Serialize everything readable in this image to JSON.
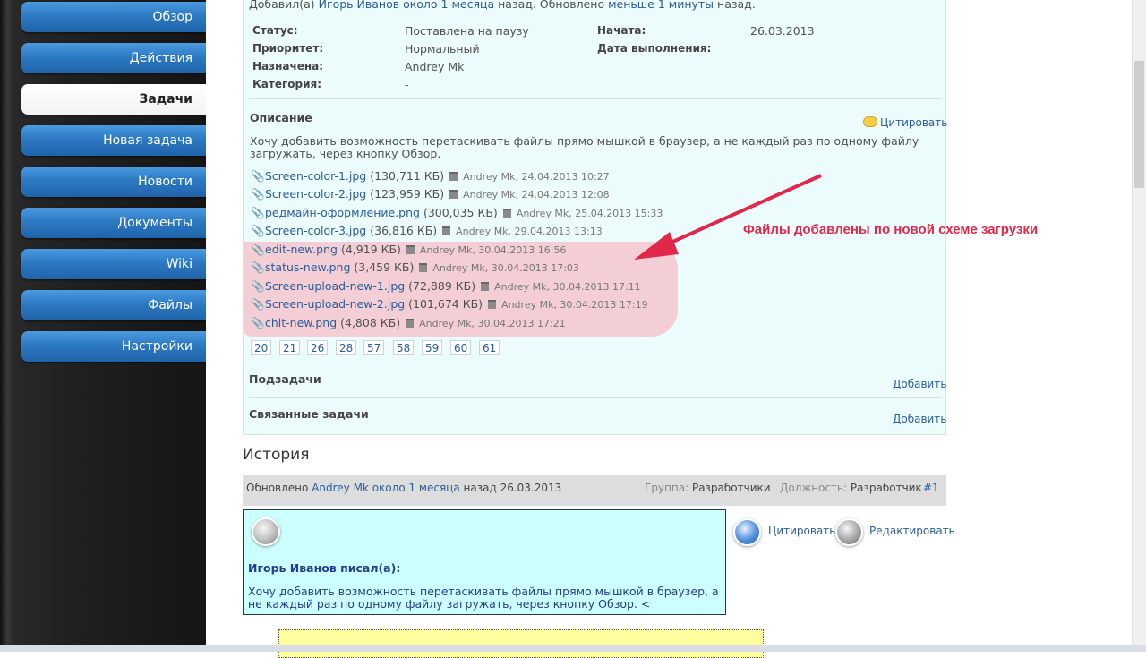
{
  "nav": {
    "items": [
      {
        "label": "Обзор",
        "active": false
      },
      {
        "label": "Действия",
        "active": false
      },
      {
        "label": "Задачи",
        "active": true
      },
      {
        "label": "Новая задача",
        "active": false
      },
      {
        "label": "Новости",
        "active": false
      },
      {
        "label": "Документы",
        "active": false
      },
      {
        "label": "Wiki",
        "active": false
      },
      {
        "label": "Файлы",
        "active": false
      },
      {
        "label": "Настройки",
        "active": false
      }
    ]
  },
  "issue": {
    "added_prefix": "Добавил(а)",
    "author": "Игорь Иванов",
    "added_when": "около 1 месяца",
    "added_mid": "назад. Обновлено",
    "updated_when": "меньше 1 минуты",
    "added_suffix": "назад.",
    "fields": {
      "status_label": "Статус:",
      "status": "Поставлена на паузу",
      "priority_label": "Приоритет:",
      "priority": "Нормальный",
      "assigned_label": "Назначена:",
      "assigned": "Andrey Mk",
      "category_label": "Категория:",
      "category": "-",
      "start_label": "Начата:",
      "start": "26.03.2013",
      "due_label": "Дата выполнения:",
      "due": ""
    },
    "description_title": "Описание",
    "quote_link": "Цитировать",
    "description_text_line1": "Хочу добавить возможность перетаскивать файлы прямо мышкой в браузер, а не каждый раз по одному файлу",
    "description_text_line2": "загружать, через кнопку Обзор.",
    "attachments": [
      {
        "name": "Screen-color-1.jpg",
        "size": "(130,711 КБ)",
        "meta": "Andrey Mk, 24.04.2013 10:27"
      },
      {
        "name": "Screen-color-2.jpg",
        "size": "(123,959 КБ)",
        "meta": "Andrey Mk, 24.04.2013 12:08"
      },
      {
        "name": "редмайн-оформление.png",
        "size": "(300,035 КБ)",
        "meta": "Andrey Mk, 25.04.2013 15:33"
      },
      {
        "name": "Screen-color-3.jpg",
        "size": "(36,816 КБ)",
        "meta": "Andrey Mk, 29.04.2013 13:13"
      },
      {
        "name": "edit-new.png",
        "size": "(4,919 КБ)",
        "meta": "Andrey Mk, 30.04.2013 16:56"
      },
      {
        "name": "status-new.png",
        "size": "(3,459 КБ)",
        "meta": "Andrey Mk, 30.04.2013 17:03"
      },
      {
        "name": "Screen-upload-new-1.jpg",
        "size": "(72,889 КБ)",
        "meta": "Andrey Mk, 30.04.2013 17:11"
      },
      {
        "name": "Screen-upload-new-2.jpg",
        "size": "(101,674 КБ)",
        "meta": "Andrey Mk, 30.04.2013 17:19"
      },
      {
        "name": "chit-new.png",
        "size": "(4,808 КБ)",
        "meta": "Andrey Mk, 30.04.2013 17:21"
      }
    ],
    "revisions": [
      "20",
      "21",
      "26",
      "28",
      "57",
      "58",
      "59",
      "60",
      "61"
    ],
    "subtasks_title": "Подзадачи",
    "subtasks_add": "Добавить",
    "related_title": "Связанные задачи",
    "related_add": "Добавить"
  },
  "annotation": "Файлы добавлены по новой схеме загрузки",
  "annotation_color": "#e0294a",
  "history": {
    "title": "История",
    "entry": {
      "updated_prefix": "Обновлено",
      "user": "Andrey Mk",
      "when": "около 1 месяца",
      "date_suffix": "назад 26.03.2013",
      "group_label": "Группа:",
      "group": "Разработчики",
      "role_label": "Должность:",
      "role": "Разработчик",
      "number": "#1",
      "quote_action": "Цитировать",
      "edit_action": "Редактировать",
      "quote_author": "Игорь Иванов писал(а):",
      "quote_line1": "Хочу добавить возможность перетаскивать файлы прямо мышкой в браузер, а",
      "quote_line2": "не каждый раз по одному файлу загружать, через кнопку Обзор. <"
    }
  },
  "colors": {
    "nav_blue": "#2d79c3",
    "issue_bg": "#ecfcfc",
    "highlight": "#f4cad0",
    "quote_bg": "#ccffff",
    "link": "#2a5d9a"
  }
}
